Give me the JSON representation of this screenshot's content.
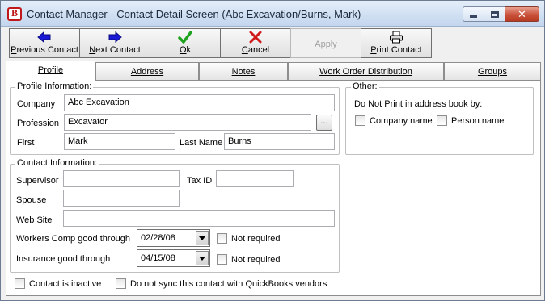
{
  "window": {
    "title": "Contact Manager - Contact Detail Screen (Abc Excavation/Burns, Mark)",
    "icon": "lb-app-icon",
    "controls": [
      "minimize-icon",
      "maximize-icon",
      "close-icon"
    ]
  },
  "toolbar": {
    "previous": {
      "mnemonic": "P",
      "rest": "revious Contact",
      "icon": "arrow-left-icon",
      "color": "#1a1ad6"
    },
    "next": {
      "mnemonic": "N",
      "rest": "ext Contact",
      "icon": "arrow-right-icon",
      "color": "#1a1ad6"
    },
    "ok": {
      "mnemonic": "O",
      "rest": "k",
      "icon": "checkmark-icon",
      "color": "#1fa31f"
    },
    "cancel": {
      "mnemonic": "C",
      "rest": "ancel",
      "icon": "x-icon",
      "color": "#d01818"
    },
    "apply": {
      "label": "Apply",
      "disabled": true
    },
    "print": {
      "mnemonic": "P",
      "rest": "rint Contact",
      "icon": "printer-icon"
    }
  },
  "tabs": {
    "profile": "Profile",
    "address": "Address",
    "notes": "Notes",
    "work_order": "Work Order Distribution",
    "groups": "Groups",
    "active": "Profile"
  },
  "profile_info": {
    "legend": "Profile Information:",
    "company_label": "Company",
    "company_value": "Abc Excavation",
    "profession_label": "Profession",
    "profession_value": "Excavator",
    "browse_label": "...",
    "first_label": "First",
    "first_value": "Mark",
    "last_label": "Last Name",
    "last_value": "Burns"
  },
  "other": {
    "legend": "Other:",
    "dnp_label": "Do Not Print in address book by:",
    "company_name": "Company name",
    "person_name": "Person name"
  },
  "contact_info": {
    "legend": "Contact Information:",
    "supervisor_label": "Supervisor",
    "supervisor_value": "",
    "taxid_label": "Tax ID",
    "taxid_value": "",
    "spouse_label": "Spouse",
    "spouse_value": "",
    "website_label": "Web Site",
    "website_value": "",
    "workers_comp_label": "Workers Comp good through",
    "workers_comp_value": "02/28/08",
    "insurance_label": "Insurance good through",
    "insurance_value": "04/15/08",
    "not_required": "Not required"
  },
  "footer": {
    "inactive": "Contact is inactive",
    "no_sync": "Do not sync this contact with QuickBooks vendors"
  }
}
